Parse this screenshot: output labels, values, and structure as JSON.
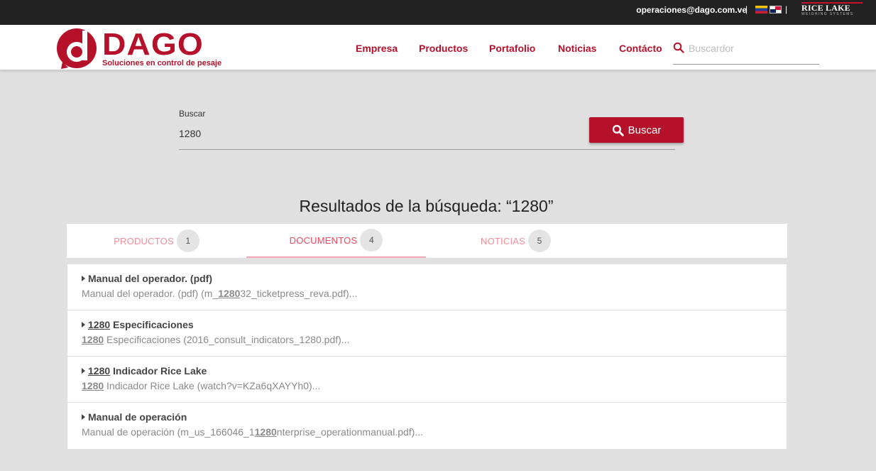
{
  "topbar": {
    "email": "operaciones@dago.com.ve",
    "separator": "|",
    "brand_name": "RICE LAKE",
    "brand_sub": "WEIGHING SYSTEMS"
  },
  "header": {
    "logo_text": "DAGO",
    "logo_tagline": "Soluciones en control de pesaje",
    "nav": [
      "Empresa",
      "Productos",
      "Portafolio",
      "Noticias",
      "Contácto"
    ],
    "search_placeholder": "Buscardor"
  },
  "search": {
    "label": "Buscar",
    "value": "1280",
    "button_label": "Buscar"
  },
  "results_title": "Resultados de la búsqueda: “1280”",
  "tabs": [
    {
      "label": "PRODUCTOS",
      "count": "1",
      "active": false
    },
    {
      "label": "DOCUMENTOS",
      "count": "4",
      "active": true
    },
    {
      "label": "NOTICIAS",
      "count": "5",
      "active": false
    }
  ],
  "results": [
    {
      "title": {
        "pre": "",
        "hl": "",
        "post": "Manual del operador. (pdf)"
      },
      "desc": {
        "pre": "Manual del operador. (pdf) (m_",
        "hl": "1280",
        "post": "32_ticketpress_reva.pdf)..."
      }
    },
    {
      "title": {
        "pre": "",
        "hl": "1280",
        "post": " Especificaciones"
      },
      "desc": {
        "pre": "",
        "hl": "1280",
        "post": " Especificaciones (2016_consult_indicators_1280.pdf)..."
      }
    },
    {
      "title": {
        "pre": "",
        "hl": "1280",
        "post": " Indicador Rice Lake"
      },
      "desc": {
        "pre": "",
        "hl": "1280",
        "post": " Indicador Rice Lake (watch?v=KZa6qXAYYh0)..."
      }
    },
    {
      "title": {
        "pre": "",
        "hl": "",
        "post": "Manual de operación"
      },
      "desc": {
        "pre": "Manual de operación (m_us_166046_1",
        "hl": "1280",
        "post": "nterprise_operationmanual.pdf)..."
      }
    }
  ],
  "colors": {
    "brand": "#b5112b",
    "tab_active": "#e8485c",
    "tab_inactive": "#f08c99"
  }
}
